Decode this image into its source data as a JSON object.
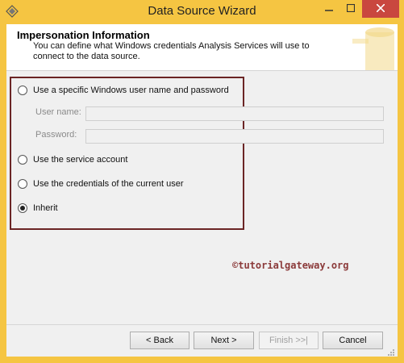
{
  "window": {
    "title": "Data Source Wizard"
  },
  "header": {
    "title": "Impersonation Information",
    "description": "You can define what Windows credentials Analysis Services will use to connect to the data source."
  },
  "options": [
    {
      "label": "Use a specific Windows user name and password",
      "checked": false
    },
    {
      "label": "Use the service account",
      "checked": false
    },
    {
      "label": "Use the credentials of the current user",
      "checked": false
    },
    {
      "label": "Inherit",
      "checked": true
    }
  ],
  "fields": {
    "username_label": "User name:",
    "username_value": "",
    "password_label": "Password:",
    "password_value": ""
  },
  "credit": "©tutorialgateway.org",
  "buttons": {
    "back": "< Back",
    "next": "Next >",
    "finish": "Finish >>|",
    "cancel": "Cancel"
  },
  "colors": {
    "frame": "#f5c542",
    "highlight_border": "#6b2525",
    "close": "#c9473f",
    "credit": "#8b3a3a"
  }
}
